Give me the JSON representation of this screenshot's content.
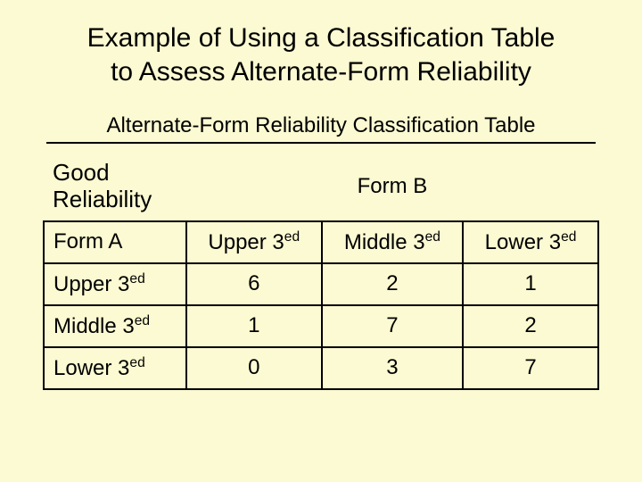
{
  "title_line1": "Example of Using a Classification Table",
  "title_line2": "to Assess Alternate-Form Reliability",
  "subtitle": "Alternate-Form Reliability Classification Table",
  "good_line1": "Good",
  "good_line2": "Reliability",
  "formB_label": "Form B",
  "formA_label": "Form A",
  "col_upper_base": "Upper 3",
  "col_middle_base": "Middle 3",
  "col_lower_base": "Lower 3",
  "row_upper_base": "Upper 3",
  "row_middle_base": "Middle 3",
  "row_lower_base": "Lower 3",
  "sup": "ed",
  "cells": {
    "r1c1": "6",
    "r1c2": "2",
    "r1c3": "1",
    "r2c1": "1",
    "r2c2": "7",
    "r2c3": "2",
    "r3c1": "0",
    "r3c2": "3",
    "r3c3": "7"
  },
  "chart_data": {
    "type": "table",
    "title": "Alternate-Form Reliability Classification Table",
    "row_labels": [
      "Upper 3ed",
      "Middle 3ed",
      "Lower 3ed"
    ],
    "col_labels": [
      "Upper 3ed",
      "Middle 3ed",
      "Lower 3ed"
    ],
    "row_axis": "Form A",
    "col_axis": "Form B",
    "values": [
      [
        6,
        2,
        1
      ],
      [
        1,
        7,
        2
      ],
      [
        0,
        3,
        7
      ]
    ],
    "annotation": "Good Reliability"
  }
}
